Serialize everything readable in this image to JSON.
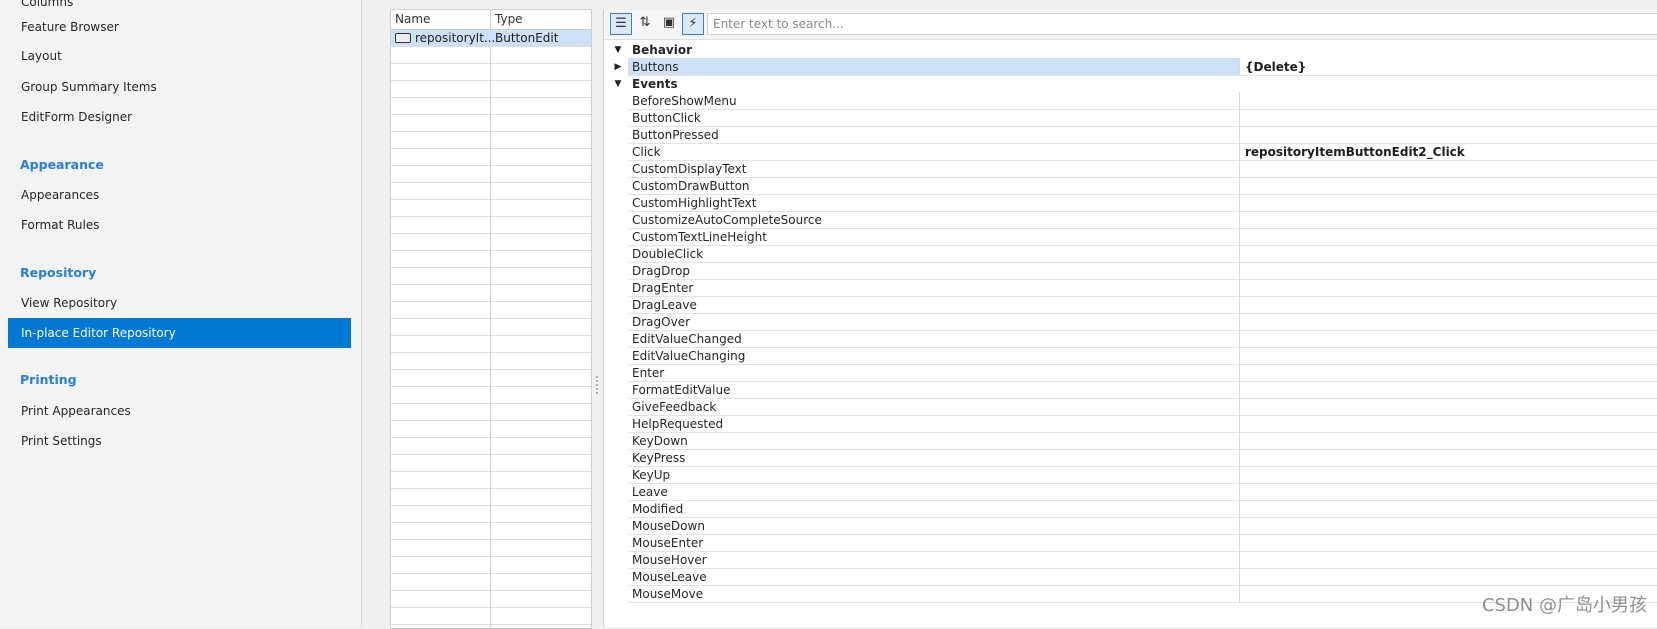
{
  "nav": {
    "partial_top": "Columns",
    "items_top": [
      "Feature Browser",
      "Layout",
      "Group Summary Items",
      "EditForm Designer"
    ],
    "appearance_header": "Appearance",
    "appearance_items": [
      "Appearances",
      "Format Rules"
    ],
    "repository_header": "Repository",
    "repository_items": [
      "View Repository",
      "In-place Editor Repository"
    ],
    "printing_header": "Printing",
    "printing_items": [
      "Print Appearances",
      "Print Settings"
    ],
    "selected": "In-place Editor Repository"
  },
  "repo_list": {
    "columns": [
      "Name",
      "Type"
    ],
    "rows": [
      {
        "name": "repositoryIt...",
        "type": "ButtonEdit",
        "icon": "button-edit-icon"
      }
    ]
  },
  "props": {
    "search_placeholder": "Enter text to search...",
    "toolbar": {
      "categorized_icon": "categorized-icon",
      "alphabetical_icon": "alphabetical-icon",
      "property_pages_icon": "property-pages-icon",
      "events_icon": "events-icon"
    },
    "behavior_category": "Behavior",
    "behavior_rows": [
      {
        "name": "Buttons",
        "value": "{Delete}"
      }
    ],
    "events_category": "Events",
    "event_rows": [
      {
        "name": "BeforeShowMenu",
        "value": ""
      },
      {
        "name": "ButtonClick",
        "value": ""
      },
      {
        "name": "ButtonPressed",
        "value": ""
      },
      {
        "name": "Click",
        "value": "repositoryItemButtonEdit2_Click"
      },
      {
        "name": "CustomDisplayText",
        "value": ""
      },
      {
        "name": "CustomDrawButton",
        "value": ""
      },
      {
        "name": "CustomHighlightText",
        "value": ""
      },
      {
        "name": "CustomizeAutoCompleteSource",
        "value": ""
      },
      {
        "name": "CustomTextLineHeight",
        "value": ""
      },
      {
        "name": "DoubleClick",
        "value": ""
      },
      {
        "name": "DragDrop",
        "value": ""
      },
      {
        "name": "DragEnter",
        "value": ""
      },
      {
        "name": "DragLeave",
        "value": ""
      },
      {
        "name": "DragOver",
        "value": ""
      },
      {
        "name": "EditValueChanged",
        "value": ""
      },
      {
        "name": "EditValueChanging",
        "value": ""
      },
      {
        "name": "Enter",
        "value": ""
      },
      {
        "name": "FormatEditValue",
        "value": ""
      },
      {
        "name": "GiveFeedback",
        "value": ""
      },
      {
        "name": "HelpRequested",
        "value": ""
      },
      {
        "name": "KeyDown",
        "value": ""
      },
      {
        "name": "KeyPress",
        "value": ""
      },
      {
        "name": "KeyUp",
        "value": ""
      },
      {
        "name": "Leave",
        "value": ""
      },
      {
        "name": "Modified",
        "value": ""
      },
      {
        "name": "MouseDown",
        "value": ""
      },
      {
        "name": "MouseEnter",
        "value": ""
      },
      {
        "name": "MouseHover",
        "value": ""
      },
      {
        "name": "MouseLeave",
        "value": ""
      },
      {
        "name": "MouseMove",
        "value": ""
      }
    ]
  },
  "watermark": "CSDN @广岛小男孩",
  "colors": {
    "accent": "#0078d4",
    "header_text": "#2680d8",
    "selection": "#cce0f7"
  }
}
